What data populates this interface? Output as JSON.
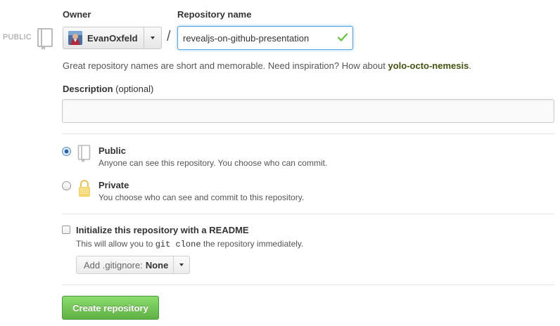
{
  "visibility_tag": "PUBLIC",
  "owner": {
    "label": "Owner",
    "name": "EvanOxfeld"
  },
  "repo": {
    "label": "Repository name",
    "value": "revealjs-on-github-presentation",
    "separator": "/"
  },
  "hint": {
    "text": "Great repository names are short and memorable. Need inspiration? How about ",
    "suggestion": "yolo-octo-nemesis",
    "end": "."
  },
  "description": {
    "label": "Description",
    "optional": "(optional)",
    "value": ""
  },
  "visibility": {
    "public": {
      "title": "Public",
      "desc": "Anyone can see this repository. You choose who can commit.",
      "selected": true
    },
    "private": {
      "title": "Private",
      "desc": "You choose who can see and commit to this repository.",
      "selected": false
    }
  },
  "readme": {
    "title": "Initialize this repository with a README",
    "desc_before": "This will allow you to ",
    "desc_code": "git clone",
    "desc_after": " the repository immediately.",
    "checked": false
  },
  "gitignore": {
    "label": "Add .gitignore:",
    "value": "None"
  },
  "create_button": "Create repository",
  "colors": {
    "accent_green": "#60b044",
    "focus_blue": "#51a7e8",
    "suggestion": "#41530f",
    "lock_yellow": "#f5d76e"
  }
}
